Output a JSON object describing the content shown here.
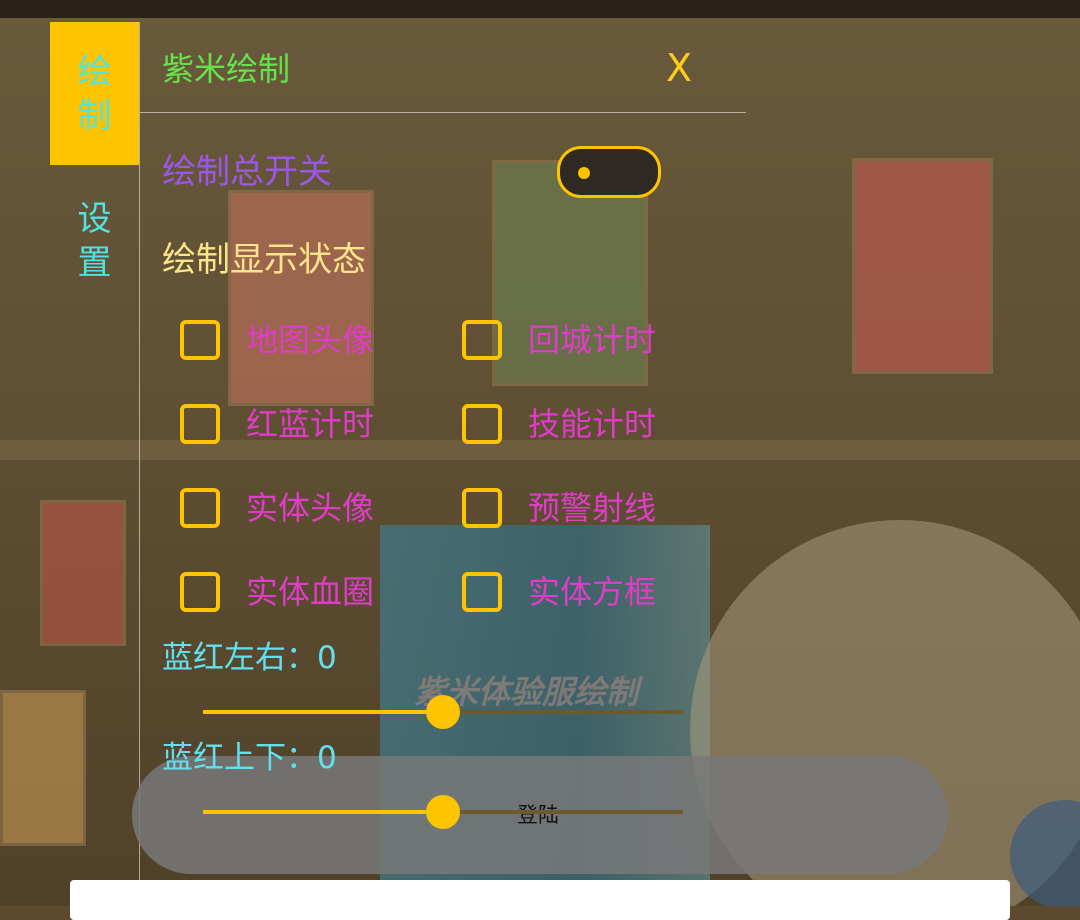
{
  "colors": {
    "accent": "#ffc400",
    "title": "#66e34a",
    "master_label": "#9b56ea",
    "option_text": "#e03cc8",
    "slider_label": "#63e0f0"
  },
  "side_tabs": [
    {
      "label_line1": "绘",
      "label_line2": "制",
      "active": true
    },
    {
      "label_line1": "设",
      "label_line2": "置",
      "active": false
    }
  ],
  "header": {
    "title": "紫米绘制",
    "close_label": "X"
  },
  "master_switch": {
    "label": "绘制总开关",
    "on": false
  },
  "display_state": {
    "heading": "绘制显示状态",
    "options": [
      {
        "label": "地图头像",
        "checked": false
      },
      {
        "label": "回城计时",
        "checked": false
      },
      {
        "label": "红蓝计时",
        "checked": false
      },
      {
        "label": "技能计时",
        "checked": false
      },
      {
        "label": "实体头像",
        "checked": false
      },
      {
        "label": "预警射线",
        "checked": false
      },
      {
        "label": "实体血圈",
        "checked": false
      },
      {
        "label": "实体方框",
        "checked": false
      }
    ]
  },
  "sliders": [
    {
      "label": "蓝红左右：0",
      "value_fraction": 0.5
    },
    {
      "label": "蓝红上下：0",
      "value_fraction": 0.5
    }
  ],
  "watermark": "紫米体验服绘制",
  "login": {
    "label": "登陆"
  }
}
